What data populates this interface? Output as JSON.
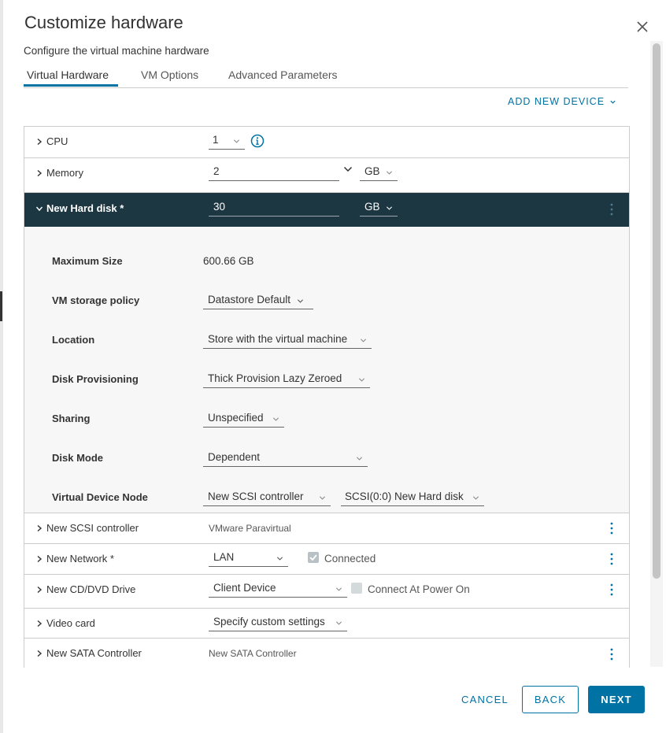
{
  "dialog": {
    "title": "Customize hardware",
    "subtitle": "Configure the virtual machine hardware"
  },
  "tabs": [
    {
      "label": "Virtual Hardware",
      "active": true
    },
    {
      "label": "VM Options",
      "active": false
    },
    {
      "label": "Advanced Parameters",
      "active": false
    }
  ],
  "add_new_device": "ADD NEW DEVICE",
  "cpu": {
    "label": "CPU",
    "value": "1",
    "info_icon": "info-icon"
  },
  "memory": {
    "label": "Memory",
    "value": "2",
    "unit": "GB"
  },
  "hard_disk": {
    "label": "New Hard disk *",
    "value": "30",
    "unit": "GB",
    "fields": {
      "max_size_label": "Maximum Size",
      "max_size_value": "600.66 GB",
      "storage_policy_label": "VM storage policy",
      "storage_policy_value": "Datastore Default",
      "location_label": "Location",
      "location_value": "Store with the virtual machine",
      "provisioning_label": "Disk Provisioning",
      "provisioning_value": "Thick Provision Lazy Zeroed",
      "sharing_label": "Sharing",
      "sharing_value": "Unspecified",
      "disk_mode_label": "Disk Mode",
      "disk_mode_value": "Dependent",
      "vdn_label": "Virtual Device Node",
      "vdn_controller": "New SCSI controller",
      "vdn_slot": "SCSI(0:0) New Hard disk"
    }
  },
  "scsi": {
    "label": "New SCSI controller",
    "value": "VMware Paravirtual"
  },
  "network": {
    "label": "New Network *",
    "value": "LAN",
    "connected_label": "Connected",
    "connected": true
  },
  "cdvd": {
    "label": "New CD/DVD Drive",
    "value": "Client Device",
    "connect_label": "Connect At Power On",
    "connect": false
  },
  "video": {
    "label": "Video card",
    "value": "Specify custom settings"
  },
  "sata": {
    "label": "New SATA Controller",
    "value": "New SATA Controller"
  },
  "footer": {
    "cancel": "CANCEL",
    "back": "BACK",
    "next": "NEXT"
  },
  "colors": {
    "accent": "#0072a3",
    "header_dark": "#1c3642",
    "expanded_bg": "#f7f7f7"
  }
}
